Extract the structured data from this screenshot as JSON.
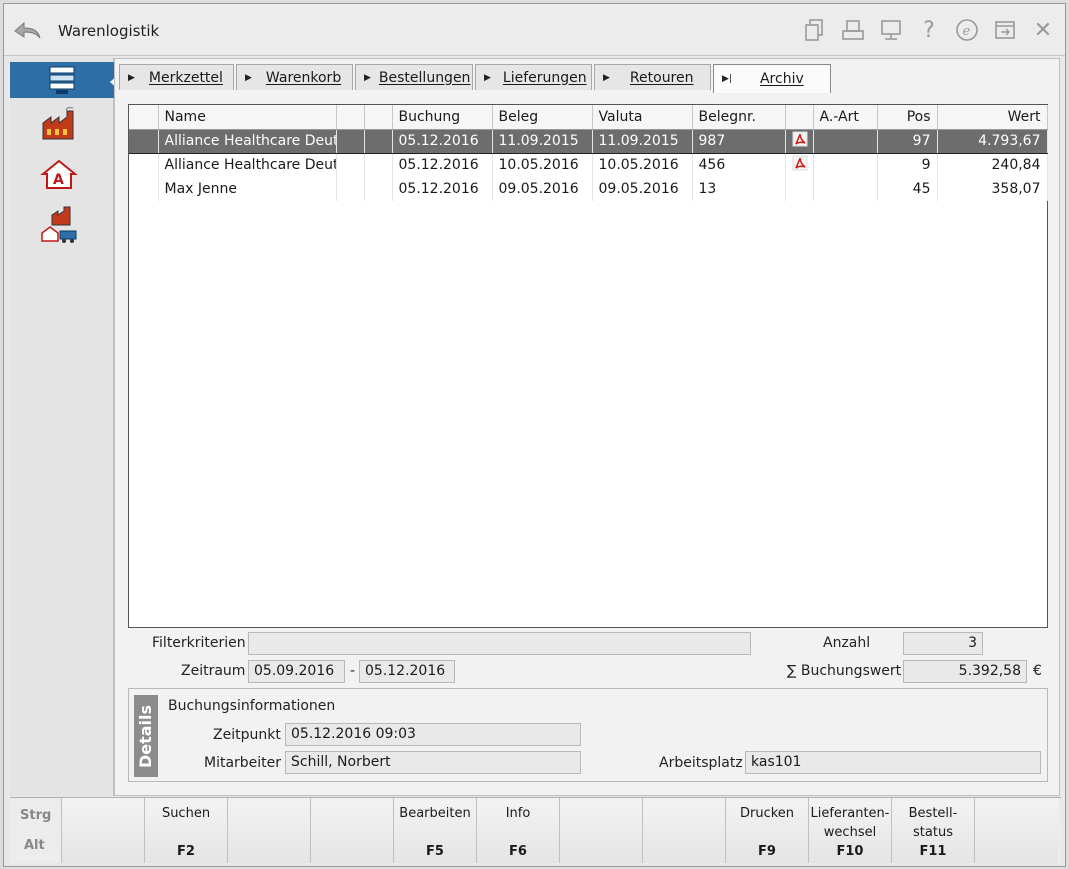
{
  "window": {
    "title": "Warenlogistik"
  },
  "tabs": [
    {
      "label": "Merkzettel"
    },
    {
      "label": "Warenkorb"
    },
    {
      "label": "Bestellungen"
    },
    {
      "label": "Lieferungen"
    },
    {
      "label": "Retouren"
    },
    {
      "label": "Archiv"
    }
  ],
  "table": {
    "headers": [
      "Name",
      "",
      "",
      "Buchung",
      "Beleg",
      "Valuta",
      "Belegnr.",
      "",
      "A.-Art",
      "Pos",
      "Wert"
    ],
    "rows": [
      {
        "name": "Alliance Healthcare Deutsc",
        "buchung": "05.12.2016",
        "beleg": "11.09.2015",
        "valuta": "11.09.2015",
        "belegnr": "987",
        "pdf": true,
        "aart": "",
        "pos": "97",
        "wert": "4.793,67"
      },
      {
        "name": "Alliance Healthcare Deutsc",
        "buchung": "05.12.2016",
        "beleg": "10.05.2016",
        "valuta": "10.05.2016",
        "belegnr": "456",
        "pdf": true,
        "aart": "",
        "pos": "9",
        "wert": "240,84"
      },
      {
        "name": "Max Jenne",
        "buchung": "05.12.2016",
        "beleg": "09.05.2016",
        "valuta": "09.05.2016",
        "belegnr": "13",
        "pdf": false,
        "aart": "",
        "pos": "45",
        "wert": "358,07"
      }
    ]
  },
  "filter": {
    "filterkriterien_label": "Filterkriterien",
    "filterkriterien_value": "",
    "zeitraum_label": "Zeitraum",
    "zeitraum_from": "05.09.2016",
    "zeitraum_sep": "-",
    "zeitraum_to": "05.12.2016",
    "anzahl_label": "Anzahl",
    "anzahl_value": "3",
    "buchungswert_label": "∑ Buchungswert",
    "buchungswert_value": "5.392,58",
    "currency": "€"
  },
  "details": {
    "tag": "Details",
    "heading": "Buchungsinformationen",
    "zeitpunkt_label": "Zeitpunkt",
    "zeitpunkt_value": "05.12.2016 09:03",
    "mitarbeiter_label": "Mitarbeiter",
    "mitarbeiter_value": "Schill, Norbert",
    "arbeitsplatz_label": "Arbeitsplatz",
    "arbeitsplatz_value": "kas101"
  },
  "fkeys": {
    "strg": "Strg",
    "alt": "Alt",
    "keys": [
      {
        "label": "",
        "key": ""
      },
      {
        "label": "Suchen",
        "key": "F2"
      },
      {
        "label": "",
        "key": ""
      },
      {
        "label": "",
        "key": ""
      },
      {
        "label": "Bearbeiten",
        "key": "F5"
      },
      {
        "label": "Info",
        "key": "F6"
      },
      {
        "label": "",
        "key": ""
      },
      {
        "label": "",
        "key": ""
      },
      {
        "label": "Drucken",
        "key": "F9"
      },
      {
        "label": "Lieferanten-\nwechsel",
        "key": "F10"
      },
      {
        "label": "Bestell-\nstatus",
        "key": "F11"
      },
      {
        "label": "",
        "key": ""
      }
    ]
  },
  "colors": {
    "accent": "#2d6ea6",
    "selected_row": "#6d6d6d",
    "pdf_red": "#d32020"
  }
}
